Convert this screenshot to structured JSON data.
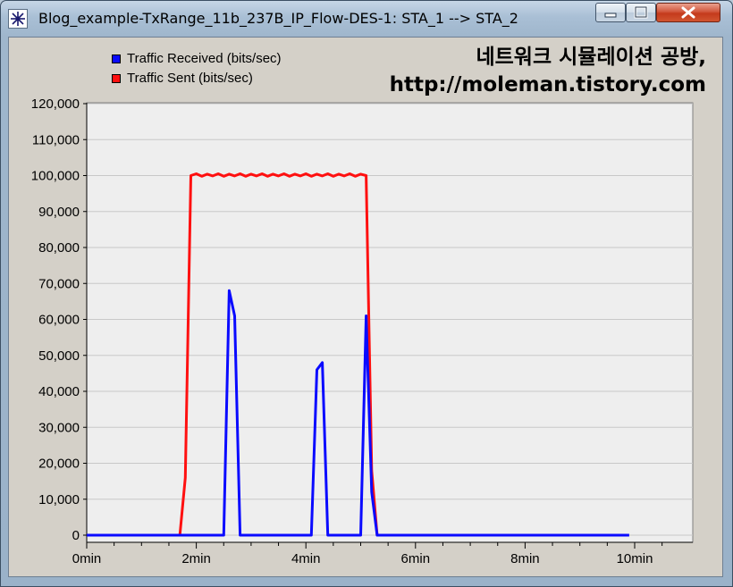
{
  "window": {
    "title": "Blog_example-TxRange_11b_237B_IP_Flow-DES-1: STA_1 --> STA_2",
    "minimize_icon": "minimize-icon",
    "maximize_icon": "maximize-icon",
    "close_icon": "close-icon"
  },
  "watermark": {
    "line1": "네트워크 시뮬레이션 공방,",
    "line2": "http://moleman.tistory.com"
  },
  "colors": {
    "received": "#0a0aff",
    "sent": "#ff1010",
    "plot_background": "#eeeeee",
    "gridline": "#c8c8c8"
  },
  "chart_data": {
    "type": "line",
    "title": "",
    "xlabel": "",
    "ylabel": "",
    "x_unit": "min",
    "xlim": [
      0,
      11
    ],
    "ylim": [
      0,
      120000
    ],
    "grid": true,
    "legend_position": "top-left",
    "x_ticks": [
      "0min",
      "2min",
      "4min",
      "6min",
      "8min",
      "10min"
    ],
    "x_tick_values": [
      0,
      2,
      4,
      6,
      8,
      10
    ],
    "y_ticks": [
      "0",
      "10,000",
      "20,000",
      "30,000",
      "40,000",
      "50,000",
      "60,000",
      "70,000",
      "80,000",
      "90,000",
      "100,000",
      "110,000",
      "120,000"
    ],
    "y_tick_values": [
      0,
      10000,
      20000,
      30000,
      40000,
      50000,
      60000,
      70000,
      80000,
      90000,
      100000,
      110000,
      120000
    ],
    "series": [
      {
        "name": "Traffic Received (bits/sec)",
        "color": "#0a0aff",
        "x": [
          0.0,
          2.5,
          2.6,
          2.7,
          2.8,
          4.1,
          4.2,
          4.3,
          4.4,
          5.0,
          5.1,
          5.2,
          5.3,
          9.9
        ],
        "y": [
          0,
          0,
          68000,
          61000,
          0,
          0,
          46000,
          48000,
          0,
          0,
          61000,
          12000,
          0,
          0
        ]
      },
      {
        "name": "Traffic Sent (bits/sec)",
        "color": "#ff1010",
        "x": [
          1.7,
          1.8,
          1.9,
          2.0,
          2.1,
          2.2,
          2.3,
          2.4,
          2.5,
          2.6,
          2.7,
          2.8,
          2.9,
          3.0,
          3.1,
          3.2,
          3.3,
          3.4,
          3.5,
          3.6,
          3.7,
          3.8,
          3.9,
          4.0,
          4.1,
          4.2,
          4.3,
          4.4,
          4.5,
          4.6,
          4.7,
          4.8,
          4.9,
          5.0,
          5.1,
          5.2,
          5.3
        ],
        "y": [
          0,
          16000,
          100000,
          100500,
          99800,
          100400,
          99900,
          100500,
          99800,
          100400,
          99900,
          100500,
          99800,
          100400,
          99900,
          100500,
          99800,
          100400,
          99900,
          100500,
          99800,
          100400,
          99900,
          100500,
          99800,
          100400,
          99900,
          100500,
          99800,
          100400,
          99900,
          100500,
          99800,
          100400,
          100000,
          18000,
          0
        ]
      }
    ]
  }
}
